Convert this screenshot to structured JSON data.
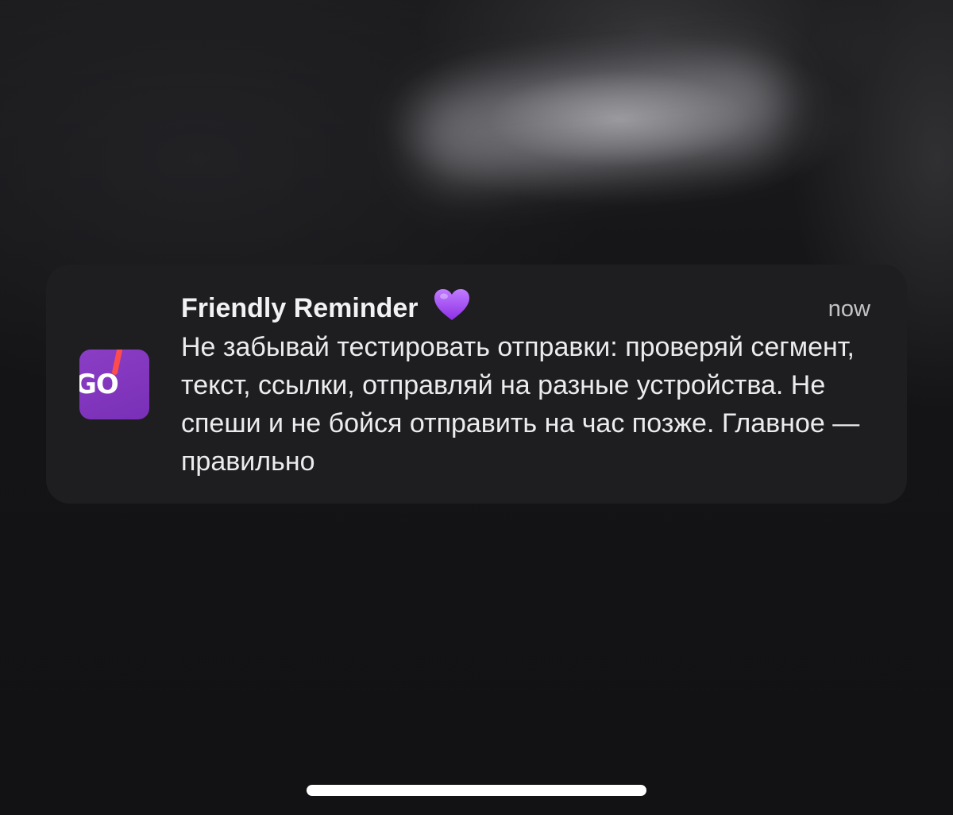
{
  "notification": {
    "app_name": "GO",
    "title": "Friendly Reminder",
    "emoji_icon": "purple-heart-icon",
    "time": "now",
    "body": "Не забывай тестировать отправки: проверяй сегмент, текст, ссылки, отправляй на разные устройства. Не спеши и не бойся отправить на час позже. Главное — правильно"
  },
  "colors": {
    "app_icon": "#8a3ec4",
    "heart": "#a855f7",
    "notification_bg": "#1e1e20"
  }
}
